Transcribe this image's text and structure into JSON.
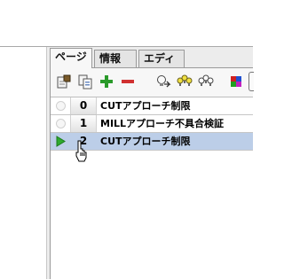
{
  "tabs": [
    {
      "label": "ページ",
      "active": true
    },
    {
      "label": "情報",
      "active": false
    },
    {
      "label": "エディタ",
      "active": false
    }
  ],
  "toolbar": {
    "buttons": [
      {
        "icon": "page-properties-icon"
      },
      {
        "icon": "duplicate-page-icon"
      },
      {
        "icon": "add-page-icon"
      },
      {
        "icon": "remove-page-icon"
      },
      {
        "icon": "lightbulb-arrow-icon"
      },
      {
        "icon": "lightbulbs-on-icon"
      },
      {
        "icon": "lightbulbs-off-icon"
      },
      {
        "icon": "color-palette-icon"
      }
    ]
  },
  "pages": [
    {
      "number": "0",
      "name": "CUTアプローチ制限",
      "selected": false,
      "playing": false
    },
    {
      "number": "1",
      "name": "MILLアプローチ不具合検証",
      "selected": false,
      "playing": false
    },
    {
      "number": "2",
      "name": "CUTアプローチ制限",
      "selected": true,
      "playing": true
    }
  ],
  "colors": {
    "selection": "#bccee8",
    "play_green": "#2eaa2e",
    "add_green": "#2a9a2a",
    "remove_red": "#d03030"
  }
}
